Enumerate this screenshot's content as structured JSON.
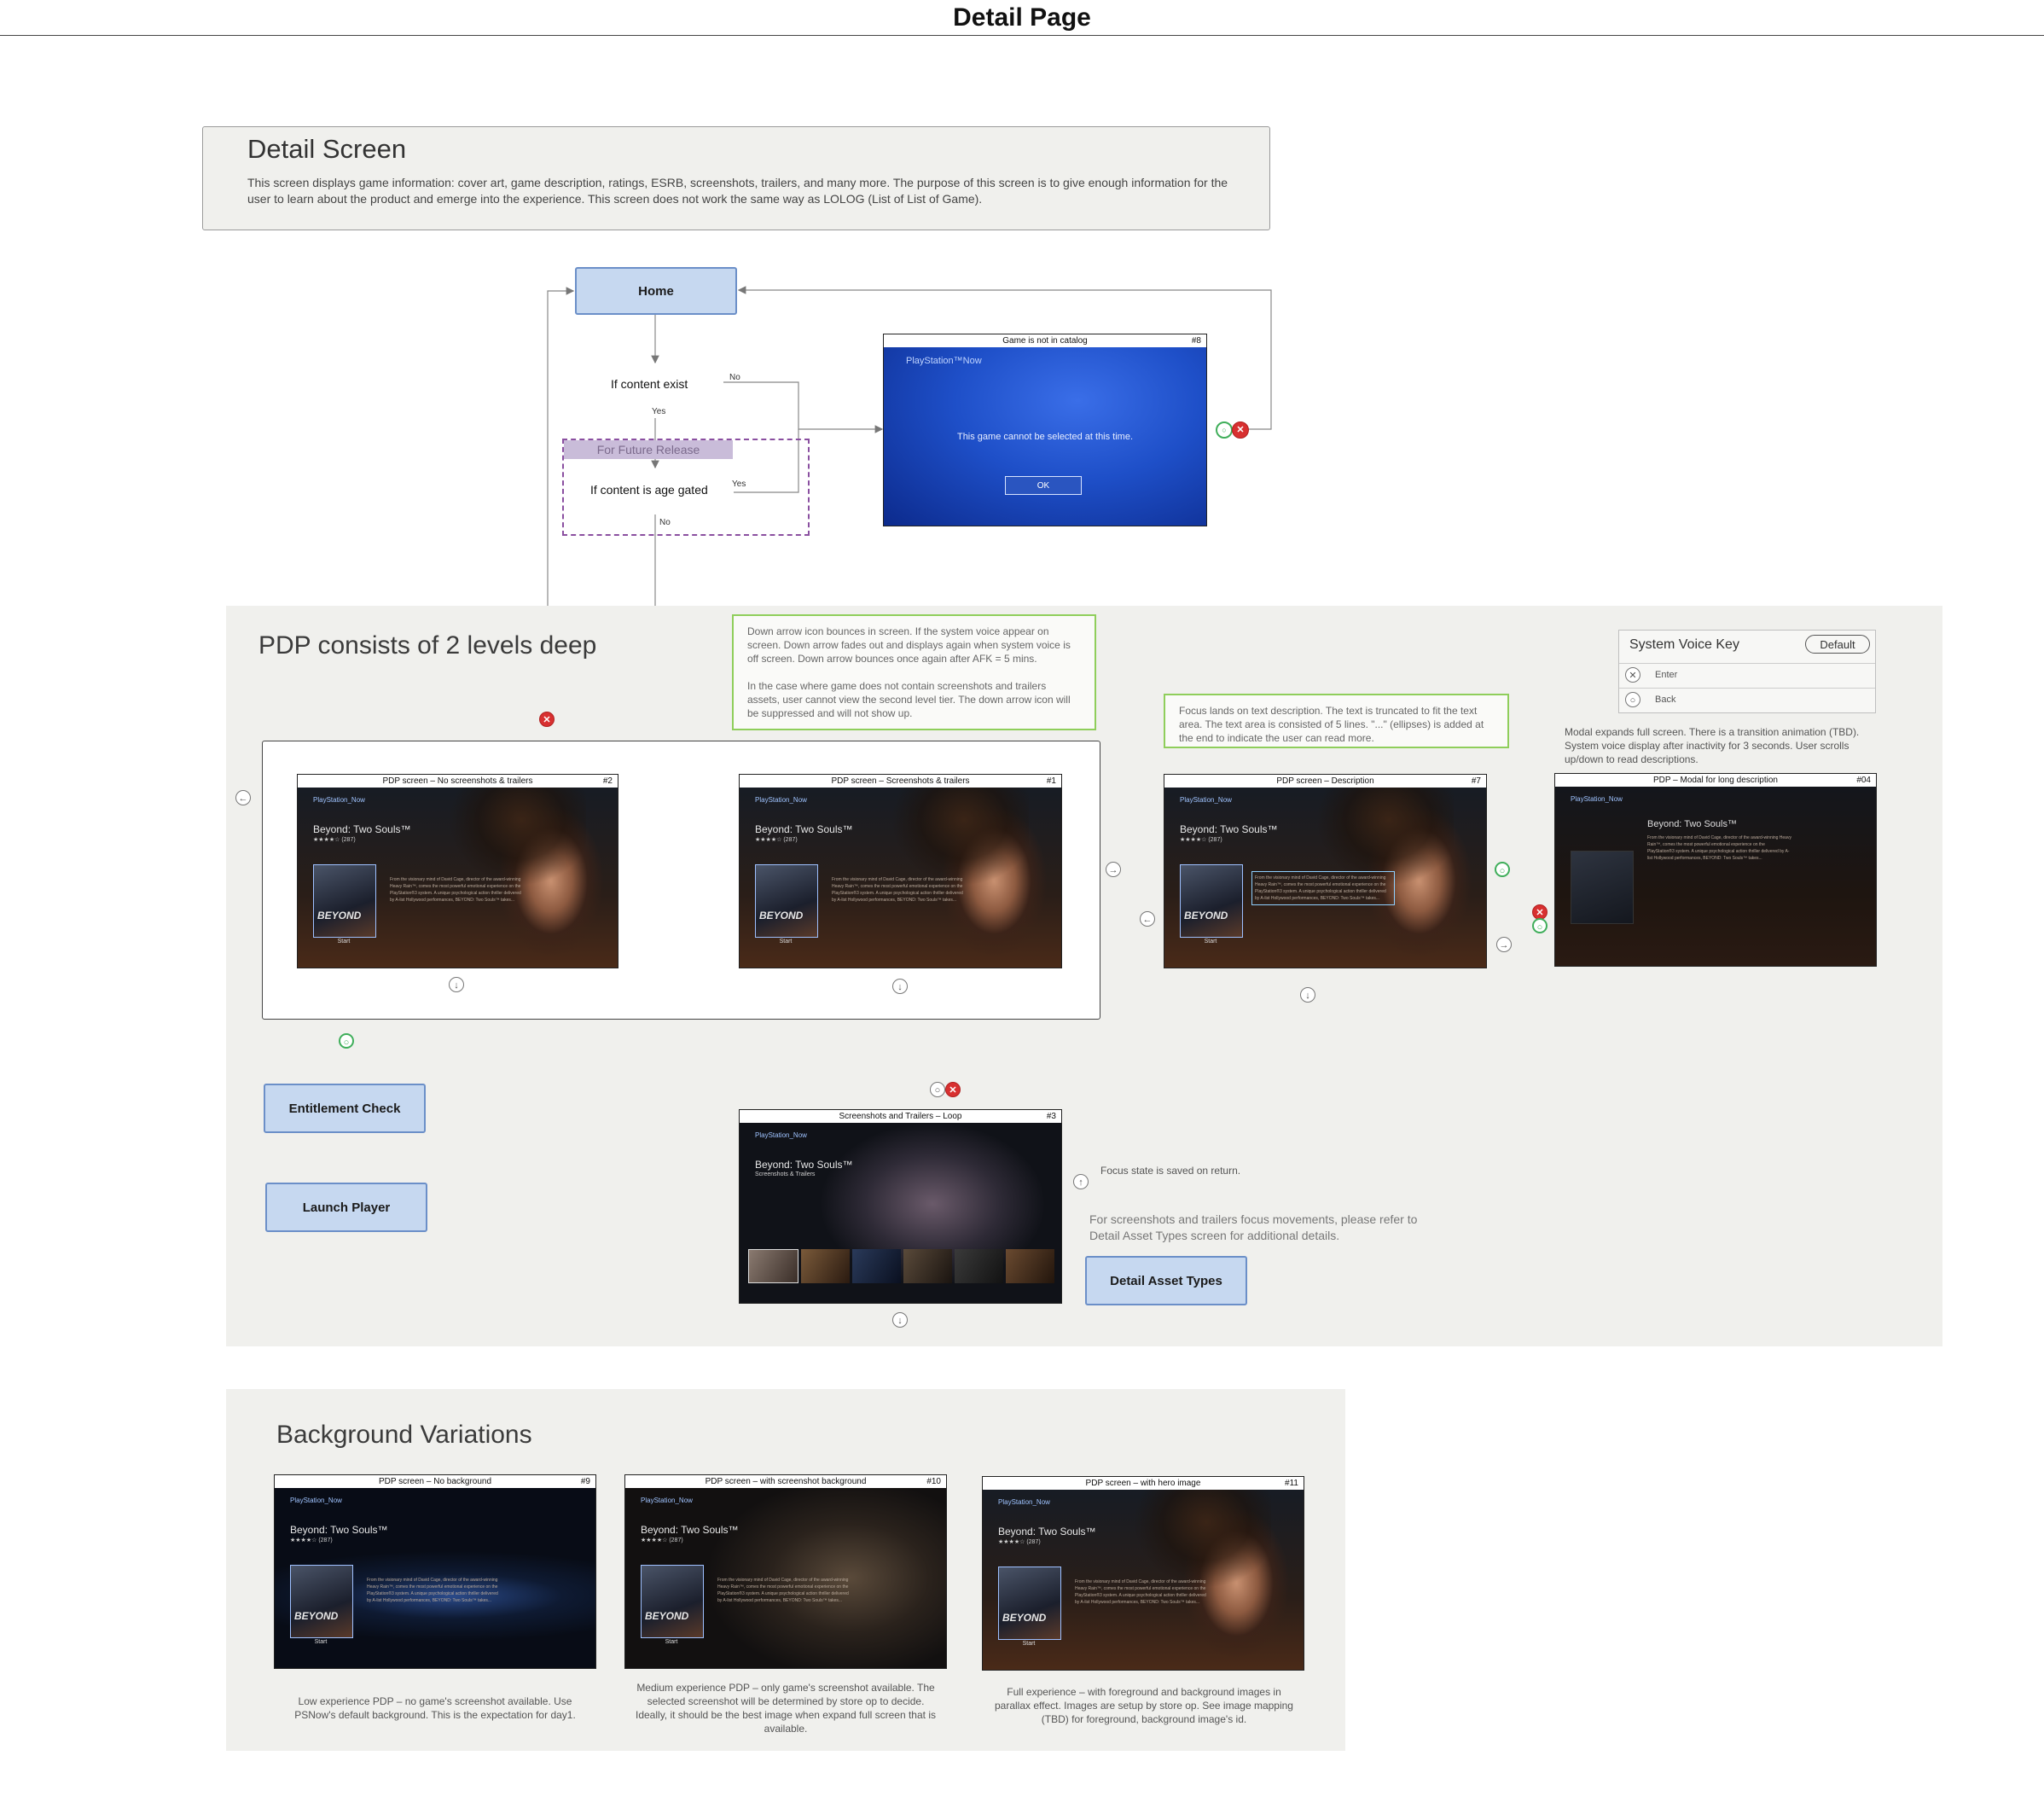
{
  "page": {
    "title": "Detail Page"
  },
  "intro": {
    "title": "Detail Screen",
    "text": "This screen displays game information: cover art, game description, ratings, ESRB, screenshots, trailers, and many more. The purpose of this screen is to give enough information for the user to learn about the product and emerge into the experience. This screen does not work the same way as LOLOG (List of List of Game)."
  },
  "flow": {
    "home": "Home",
    "if_content_exist": "If content exist",
    "no_label": "No",
    "yes_label": "Yes",
    "future_release": "For Future Release",
    "if_age_gated": "If content is age gated",
    "yes_label2": "Yes",
    "no_label2": "No",
    "entitlement_check": "Entitlement Check",
    "launch_player": "Launch Player",
    "detail_asset_types": "Detail Asset Types"
  },
  "not_in_catalog": {
    "header": "Game is not in catalog",
    "num": "#8",
    "brand": "PlayStation™Now",
    "message": "This game cannot be selected at this time.",
    "ok": "OK"
  },
  "pdp_section": {
    "title": "PDP consists of 2 levels deep",
    "note_arrow_p1": "Down arrow icon bounces in screen. If the system voice appear on screen. Down arrow fades out and displays again when system voice is off screen. Down arrow bounces once again after AFK = 5 mins.",
    "note_arrow_p2": "In the case where game does not contain screenshots and trailers assets, user cannot view the second level tier. The down arrow icon will be suppressed and will not show up.",
    "note_focus": "Focus lands on text description. The text is truncated to fit the text area. The text area is consisted of 5 lines. \"...\" (ellipses) is added at the end to indicate the user can read more.",
    "note_modal": "Modal expands full screen. There is a transition animation (TBD). System voice display after inactivity for 3 seconds. User scrolls up/down to read descriptions.",
    "note_focus_saved": "Focus state is saved on return.",
    "note_asset": "For screenshots and trailers focus movements, please refer to Detail Asset Types screen for additional details."
  },
  "voice_key": {
    "title": "System Voice Key",
    "default": "Default",
    "enter": "Enter",
    "back": "Back"
  },
  "screens": {
    "s2": {
      "header": "PDP screen – No screenshots & trailers",
      "num": "#2"
    },
    "s1": {
      "header": "PDP screen – Screenshots & trailers",
      "num": "#1"
    },
    "s7": {
      "header": "PDP screen – Description",
      "num": "#7"
    },
    "s04": {
      "header": "PDP – Modal for long description",
      "num": "#04"
    },
    "s3": {
      "header": "Screenshots and Trailers – Loop",
      "num": "#3",
      "sub": "Screenshots & Trailers"
    },
    "s9": {
      "header": "PDP screen – No background",
      "num": "#9"
    },
    "s10": {
      "header": "PDP screen – with screenshot background",
      "num": "#10"
    },
    "s11": {
      "header": "PDP screen – with hero image",
      "num": "#11"
    }
  },
  "game": {
    "brand": "PlayStation_Now",
    "title": "Beyond: Two Souls™",
    "stars": "★★★★☆ (287)",
    "cover_text": "BEYOND",
    "start": "Start",
    "desc": "From the visionary mind of David Cage, director of the award-winning Heavy Rain™, comes the most powerful emotional experience on the PlayStation®3 system. A unique psychological action thriller delivered by A-list Hollywood performances, BEYOND: Two Souls™ takes..."
  },
  "bg_section": {
    "title": "Background Variations",
    "cap9": "Low experience PDP – no game's screenshot available. Use PSNow's default background. This is the expectation for day1.",
    "cap10": "Medium experience PDP – only game's screenshot available. The selected screenshot will be determined by store op to decide. Ideally, it should be the best image when expand full screen that is available.",
    "cap11": "Full experience – with foreground and background images in parallax effect. Images are setup by store op. See image mapping (TBD) for foreground, background image's id."
  }
}
